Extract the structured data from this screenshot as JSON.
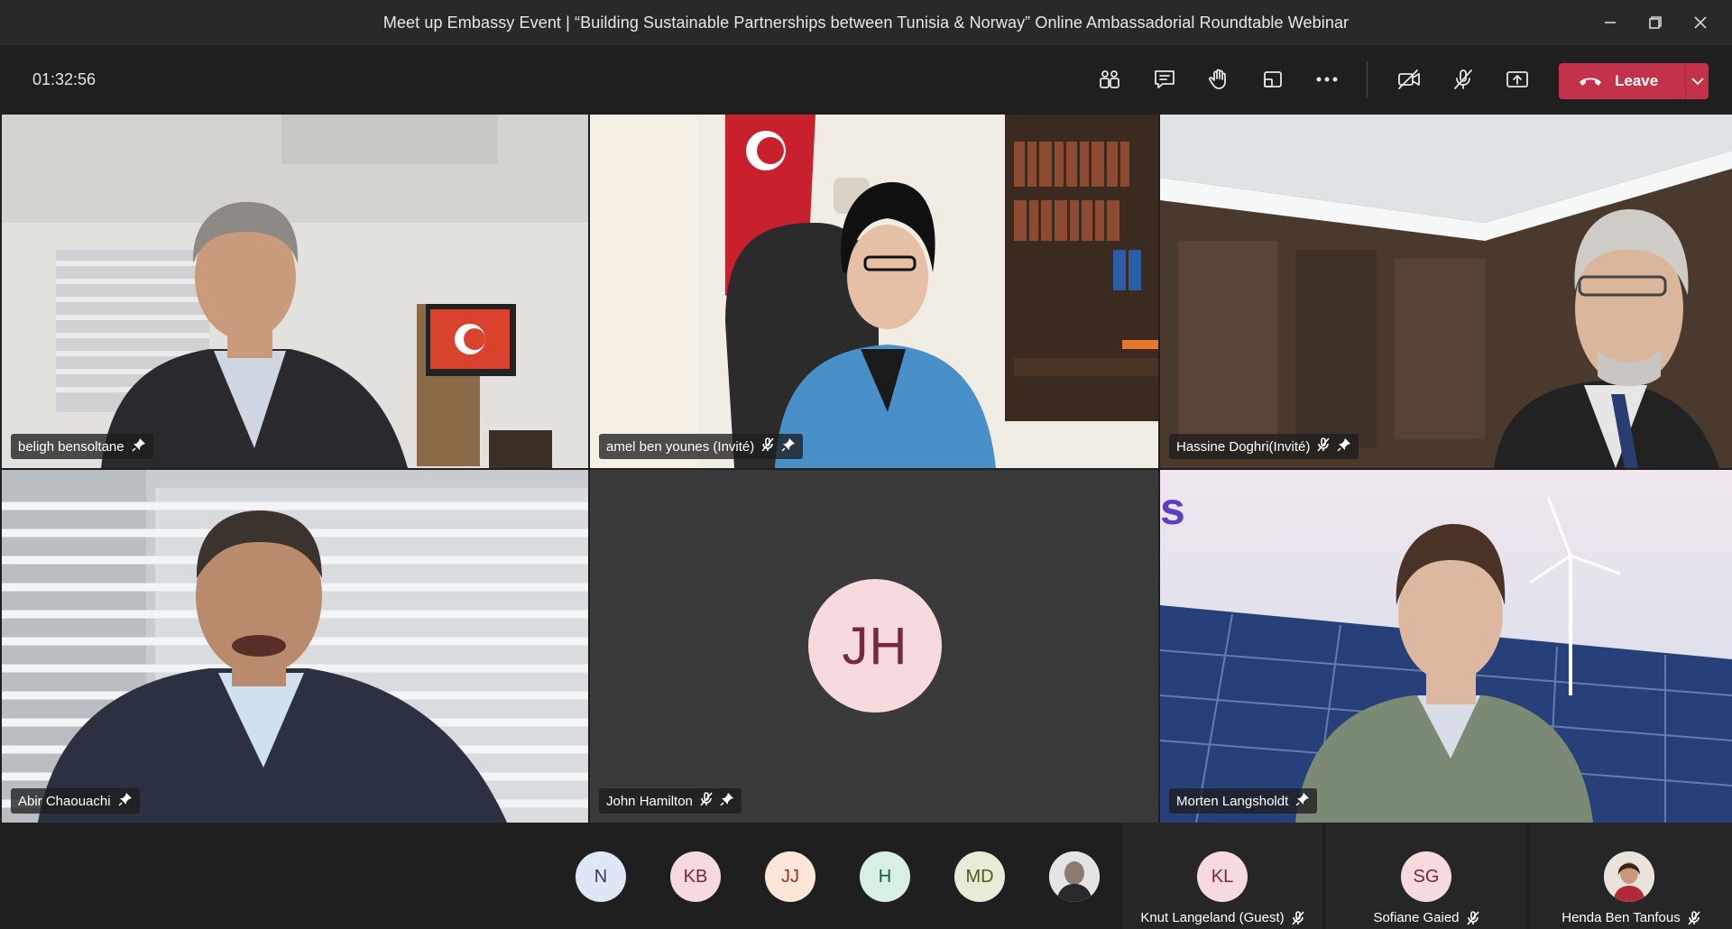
{
  "window": {
    "title": "Meet up Embassy Event | “Building Sustainable Partnerships between Tunisia & Norway” Online Ambassadorial Roundtable Webinar"
  },
  "toolbar": {
    "timer": "01:32:56",
    "icons": [
      "participants-icon",
      "chat-icon",
      "raise-hand-icon",
      "share-tray-icon",
      "more-options-icon",
      "camera-off-icon",
      "mic-off-icon",
      "share-screen-icon"
    ],
    "leave_label": "Leave",
    "leave_color": "#c4314b"
  },
  "video_tiles": [
    {
      "name": "beligh bensoltane",
      "muted": false,
      "pinned": true
    },
    {
      "name": "amel ben younes (Invité)",
      "muted": true,
      "pinned": true
    },
    {
      "name": "Hassine Doghri(Invité)",
      "muted": true,
      "pinned": true
    },
    {
      "name": "Abir Chaouachi",
      "muted": false,
      "pinned": true
    },
    {
      "name": "John Hamilton",
      "muted": true,
      "pinned": true,
      "initials": "JH"
    },
    {
      "name": "Morten Langsholdt",
      "muted": false,
      "pinned": true
    }
  ],
  "overflow_avatars": [
    {
      "initials": "N",
      "bg": "#dfe7f6",
      "fg": "#2b3a67"
    },
    {
      "initials": "KB",
      "bg": "#f7dadd",
      "fg": "#77283a"
    },
    {
      "initials": "JJ",
      "bg": "#fde5d7",
      "fg": "#8a3a1c"
    },
    {
      "initials": "H",
      "bg": "#d8efe3",
      "fg": "#1d5a3b"
    },
    {
      "initials": "MD",
      "bg": "#e7ecd6",
      "fg": "#4f5a22"
    },
    {
      "initials": "",
      "photo": true
    }
  ],
  "mini_tiles": [
    {
      "name": "Knut Langeland (Guest)",
      "initials": "KL",
      "bg": "#f7dadd",
      "fg": "#77283a",
      "muted": true
    },
    {
      "name": "Sofiane Gaied",
      "initials": "SG",
      "bg": "#f7dadd",
      "fg": "#77283a",
      "muted": true
    },
    {
      "name": "Henda Ben Tanfous",
      "initials": "",
      "photo": true,
      "muted": true
    }
  ]
}
